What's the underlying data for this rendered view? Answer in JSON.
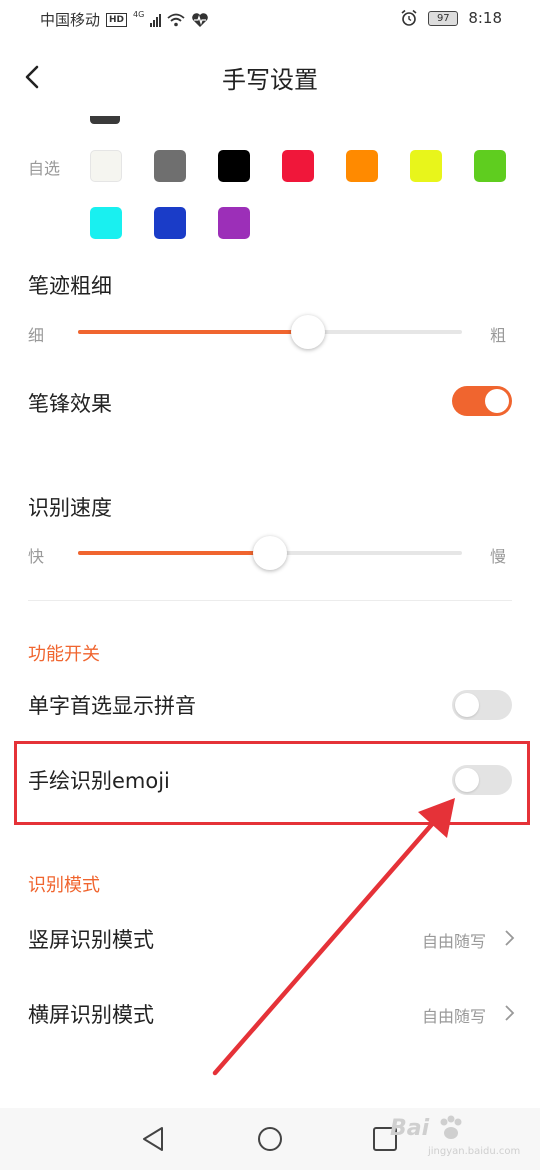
{
  "status": {
    "carrier": "中国移动",
    "hd": "HD",
    "network": "4G",
    "battery": "97",
    "time": "8:18"
  },
  "header": {
    "title": "手写设置"
  },
  "colors": {
    "label": "自选",
    "swatches": [
      "#f5f5f0",
      "#6f6f6f",
      "#000000",
      "#f0173a",
      "#ff8a00",
      "#e8f51b",
      "#5fcd1f",
      "#19f0f0",
      "#1a3cc8",
      "#9c2fb8"
    ]
  },
  "stroke": {
    "title": "笔迹粗细",
    "min_label": "细",
    "max_label": "粗",
    "value": 0.6
  },
  "tip_effect": {
    "title": "笔锋效果",
    "on": true
  },
  "speed": {
    "title": "识别速度",
    "min_label": "快",
    "max_label": "慢",
    "value": 0.5
  },
  "features": {
    "header": "功能开关",
    "pinyin": {
      "title": "单字首选显示拼音",
      "on": false
    },
    "emoji": {
      "title": "手绘识别emoji",
      "on": false
    }
  },
  "mode": {
    "header": "识别模式",
    "portrait": {
      "title": "竖屏识别模式",
      "value": "自由随写"
    },
    "landscape": {
      "title": "横屏识别模式",
      "value": "自由随写"
    }
  },
  "accent": "#f0652f",
  "highlight_color": "#e53238",
  "watermark": {
    "brand": "Bai",
    "sub": "jingyan.baidu.com"
  }
}
